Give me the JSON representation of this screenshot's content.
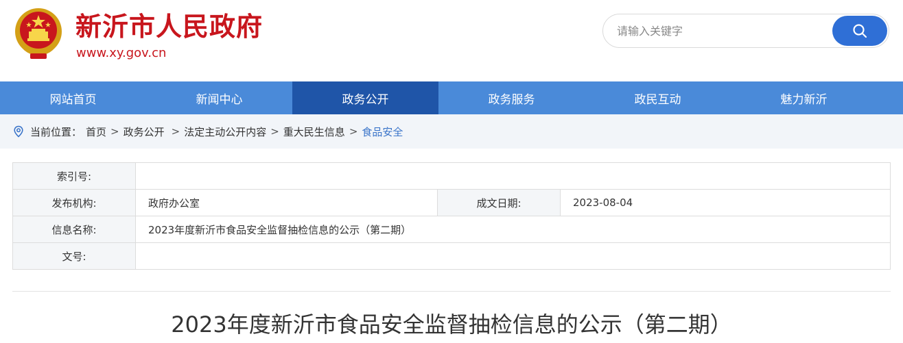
{
  "header": {
    "site_title": "新沂市人民政府",
    "site_url": "www.xy.gov.cn",
    "search_placeholder": "请输入关键字",
    "brand_color": "#c8161d",
    "accent_color": "#2f6fd6"
  },
  "nav": {
    "items": [
      {
        "label": "网站首页"
      },
      {
        "label": "新闻中心"
      },
      {
        "label": "政务公开"
      },
      {
        "label": "政务服务"
      },
      {
        "label": "政民互动"
      },
      {
        "label": "魅力新沂"
      }
    ],
    "active_label": "政务公开"
  },
  "breadcrumb": {
    "prefix": "当前位置：",
    "items": [
      "首页",
      "政务公开",
      "法定主动公开内容",
      "重大民生信息"
    ],
    "current": "食品安全",
    "separator": ">"
  },
  "meta": {
    "index_label": "索引号:",
    "index_value": "",
    "publisher_label": "发布机构:",
    "publisher_value": "政府办公室",
    "date_label": "成文日期:",
    "date_value": "2023-08-04",
    "name_label": "信息名称:",
    "name_value": "2023年度新沂市食品安全监督抽检信息的公示（第二期）",
    "docno_label": "文号:",
    "docno_value": ""
  },
  "article": {
    "title": "2023年度新沂市食品安全监督抽检信息的公示（第二期）"
  }
}
